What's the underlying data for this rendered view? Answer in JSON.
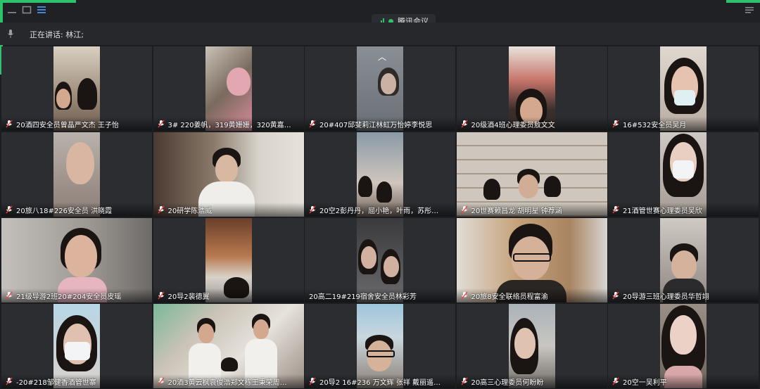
{
  "app": {
    "title": "腾讯会议",
    "accent_color": "#2dc26b"
  },
  "toolbar": {
    "icons": [
      "minimize-icon",
      "window-icon",
      "menu-list-icon",
      "settings-icon"
    ]
  },
  "speaking": {
    "text": "正在讲话: 林江;"
  },
  "participants": [
    {
      "name": "20酒四安全员曾晶严文杰 王子怡",
      "mic": "muted"
    },
    {
      "name": "3# 220姜帆，319黄姗姗，320黄嘉…",
      "mic": "muted"
    },
    {
      "name": "20#407邱斐莉江林虹万怡婷李悦思",
      "mic": "muted"
    },
    {
      "name": "20级酒4班心理委员敖文文",
      "mic": "muted"
    },
    {
      "name": "16#532安全员吴月",
      "mic": "muted"
    },
    {
      "name": "20旅八18#226安全员 洪晓霞",
      "mic": "muted"
    },
    {
      "name": "20研学陈浩威",
      "mic": "muted"
    },
    {
      "name": "20空2彭丹丹，屈小艳，叶雨，苏彤…",
      "mic": "muted"
    },
    {
      "name": "20世赛赖昌龙 胡明星 钟荐涵",
      "mic": "muted"
    },
    {
      "name": "21酒管世赛心理委员吴欣",
      "mic": "muted"
    },
    {
      "name": "21级导游2班20#204安全员皮瑶",
      "mic": "muted"
    },
    {
      "name": "20导2裴德翼",
      "mic": "muted"
    },
    {
      "name": "20高二19#219宿舍安全员林彩芳",
      "mic": "none"
    },
    {
      "name": "20旅8安全联络员程富渝",
      "mic": "muted"
    },
    {
      "name": "20导游三班心理委员华哲翊",
      "mic": "muted"
    },
    {
      "name": "-20#218邹健香酒管世寨",
      "mic": "muted"
    },
    {
      "name": "20酒3黄云枫袁俊浩郑文栋王秉荣周…",
      "mic": "muted"
    },
    {
      "name": "20导2 16#236 万文辉 张祥 戴丽遥…",
      "mic": "muted"
    },
    {
      "name": "20高三心理委员何盼盼",
      "mic": "muted"
    },
    {
      "name": "20空一吴利平",
      "mic": "muted"
    }
  ]
}
